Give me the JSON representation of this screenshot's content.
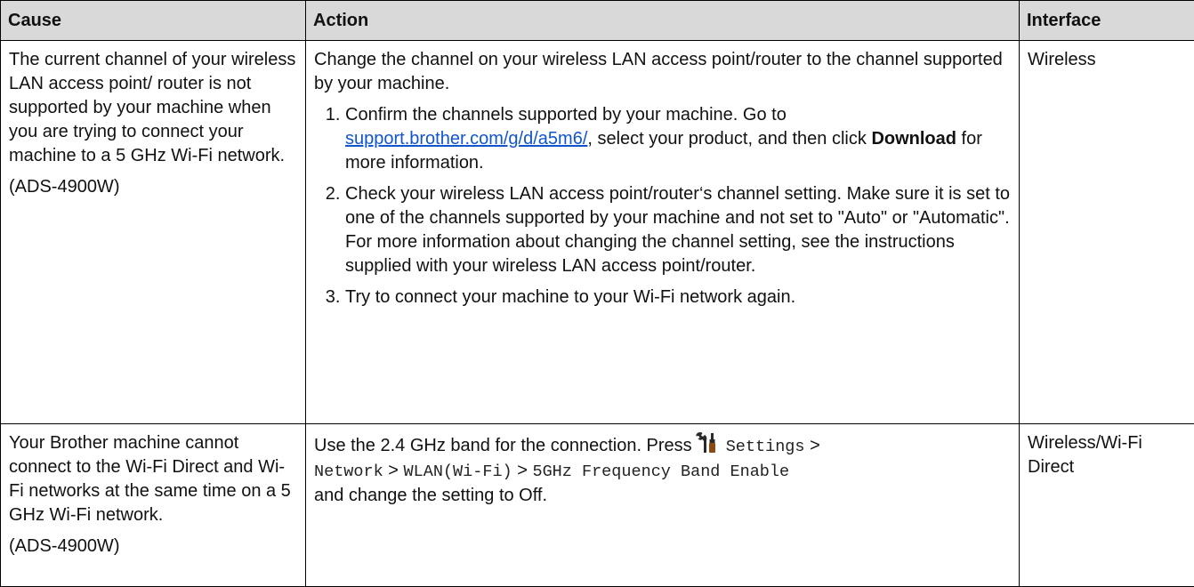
{
  "headers": {
    "cause": "Cause",
    "action": "Action",
    "interface": "Interface"
  },
  "rows": [
    {
      "cause_text": "The current channel of your wireless LAN access point/ router is not supported by your machine when you are trying to connect your machine to a 5 GHz Wi-Fi network.",
      "cause_model": "(ADS-4900W)",
      "action_intro": "Change the channel on your wireless LAN access point/router to the channel supported by your machine.",
      "steps": {
        "s1_a": "Confirm the channels supported by your machine. Go to ",
        "s1_link": "support.brother.com/g/d/a5m6/",
        "s1_b": ", select your product, and then click ",
        "s1_bold": "Download",
        "s1_c": " for more information.",
        "s2": "Check your wireless LAN access point/router‘s channel setting. Make sure it is set to one of the channels supported by your machine and not set to \"Auto\" or \"Automatic\". For more information about changing the channel setting, see the instructions supplied with your wireless LAN access point/router.",
        "s3": "Try to connect your machine to your Wi-Fi network again."
      },
      "interface": "Wireless"
    },
    {
      "cause_text": "Your Brother machine cannot connect to the Wi-Fi Direct and Wi-Fi networks at the same time on a 5 GHz Wi-Fi network.",
      "cause_model": "(ADS-4900W)",
      "action_a": "Use the 2.4 GHz band for the connection. Press",
      "settings_icon": "settings-tools-icon",
      "menu_settings": "Settings",
      "sep": ">",
      "menu_network": "Network",
      "menu_wlan": "WLAN(Wi-Fi)",
      "menu_band": "5GHz Frequency Band Enable",
      "action_b": "and change the setting to Off.",
      "interface": "Wireless/Wi-Fi Direct"
    }
  ]
}
